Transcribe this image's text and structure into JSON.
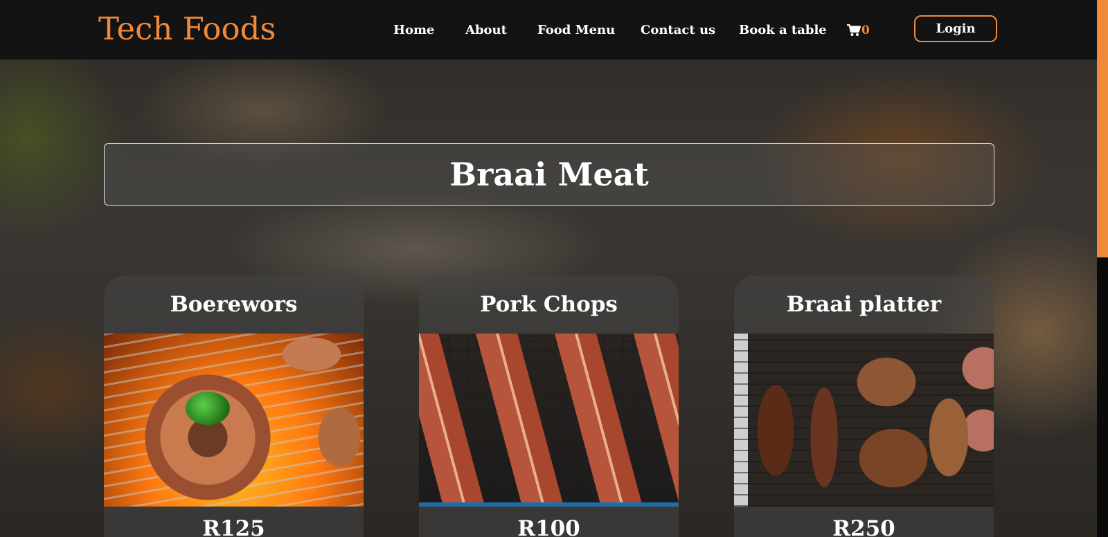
{
  "header": {
    "logo": "Tech Foods",
    "nav": [
      {
        "label": "Home"
      },
      {
        "label": "About"
      },
      {
        "label": "Food Menu"
      },
      {
        "label": "Contact us"
      },
      {
        "label": "Book a table"
      }
    ],
    "cart": {
      "icon": "cart-icon",
      "count": "0"
    },
    "login_label": "Login"
  },
  "colors": {
    "accent": "#f08a3a",
    "header_bg": "#131313",
    "text": "#ffffff"
  },
  "page": {
    "title": "Braai Meat"
  },
  "menu_items": [
    {
      "name": "Boerewors",
      "price": "R125"
    },
    {
      "name": "Pork Chops",
      "price": "R100"
    },
    {
      "name": "Braai platter",
      "price": "R250"
    }
  ]
}
